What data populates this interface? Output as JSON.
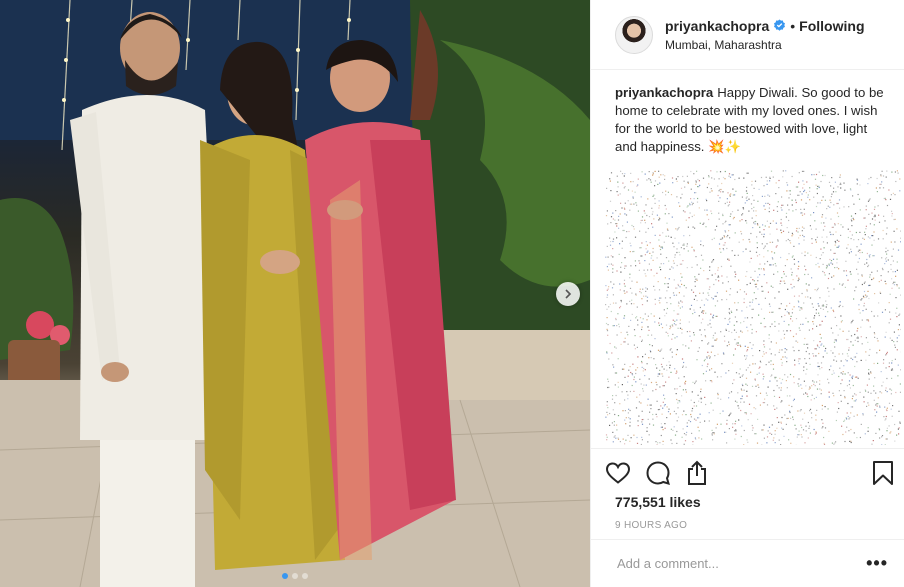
{
  "post": {
    "username": "priyankachopra",
    "verified": true,
    "separator": "•",
    "follow_label": "Following",
    "location": "Mumbai, Maharashtra",
    "caption": "Happy Diwali. So good to be home to celebrate with my loved ones. I wish for the world to be bestowed with love, light and happiness. 💥✨",
    "likes": "775,551 likes",
    "timestamp": "9 HOURS AGO",
    "comment_placeholder": "Add a comment...",
    "more_label": "•••",
    "carousel": {
      "total": 3,
      "active": 1
    }
  },
  "icons": {
    "like": "heart-icon",
    "comment": "comment-bubble-icon",
    "share": "share-icon",
    "save": "bookmark-icon",
    "next": "chevron-right-icon",
    "verified": "verified-badge-icon"
  },
  "colors": {
    "accent": "#3897f0",
    "text": "#262626",
    "muted": "#999999",
    "border": "#efefef"
  }
}
